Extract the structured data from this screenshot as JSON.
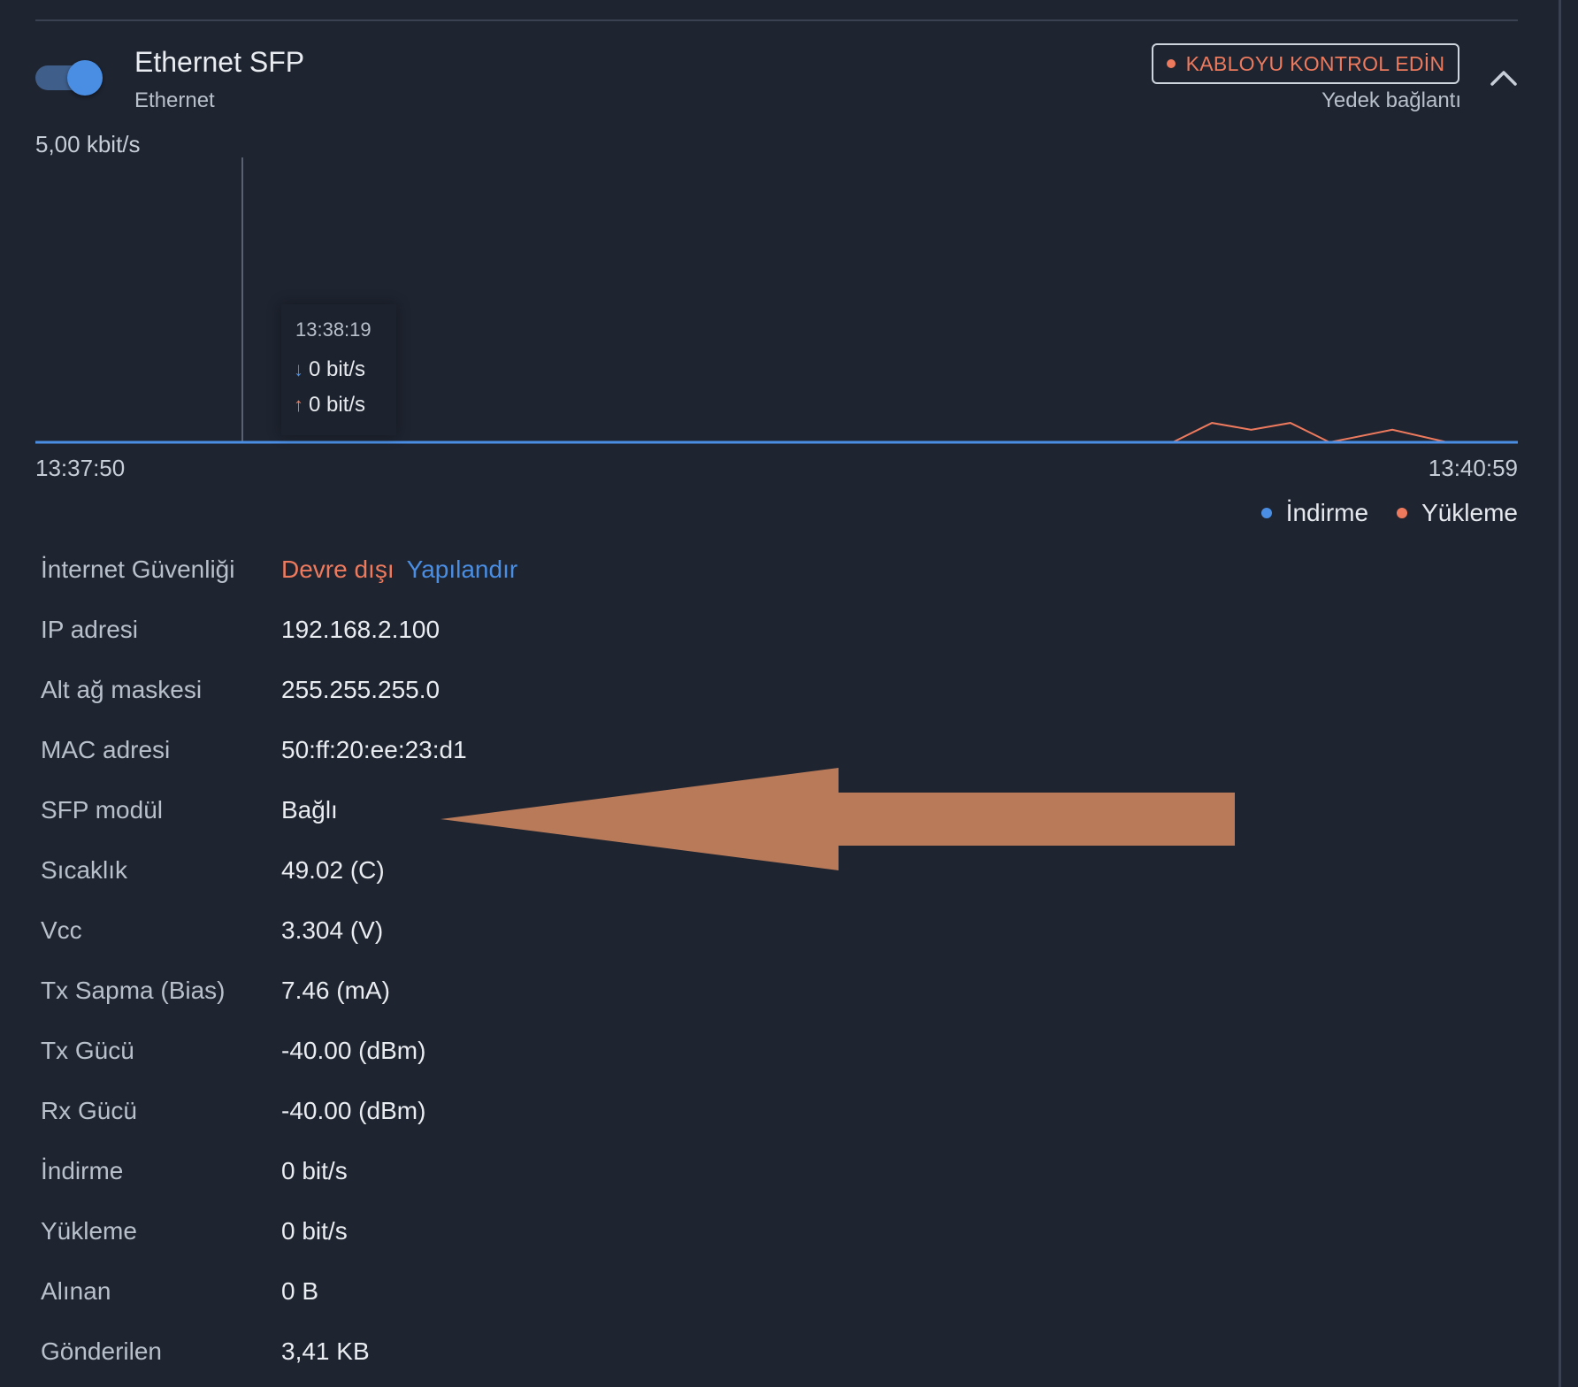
{
  "header": {
    "title": "Ethernet SFP",
    "subtitle": "Ethernet",
    "badge": "KABLOYU KONTROL EDİN",
    "backup": "Yedek bağlantı",
    "toggle_on": true
  },
  "colors": {
    "download": "#4a8ee4",
    "upload": "#ee7a5e",
    "background": "#1e2430",
    "annotation_arrow": "#b97a59"
  },
  "chart_data": {
    "type": "line",
    "ylabel": "",
    "y_max_label": "5,00 kbit/s",
    "ylim": [
      0,
      5000
    ],
    "x_start": "13:37:50",
    "x_end": "13:40:59",
    "legend_position": "bottom-right",
    "series": [
      {
        "name": "İndirme",
        "x": [
          "13:37:50",
          "13:40:59"
        ],
        "values": [
          0,
          0
        ]
      },
      {
        "name": "Yükleme",
        "x": [
          "13:37:50",
          "13:40:15",
          "13:40:20",
          "13:40:25",
          "13:40:30",
          "13:40:35",
          "13:40:43",
          "13:40:50",
          "13:40:59"
        ],
        "values": [
          0,
          0,
          340,
          220,
          340,
          0,
          220,
          0,
          0
        ]
      }
    ],
    "tooltip": {
      "time": "13:38:19",
      "download": "0 bit/s",
      "upload": "0 bit/s"
    }
  },
  "details": [
    {
      "label": "İnternet Güvenliği",
      "value": "Devre dışı",
      "action": "Yapılandır"
    },
    {
      "label": "IP adresi",
      "value": "192.168.2.100"
    },
    {
      "label": "Alt ağ maskesi",
      "value": "255.255.255.0"
    },
    {
      "label": "MAC adresi",
      "value": "50:ff:20:ee:23:d1"
    },
    {
      "label": "SFP modül",
      "value": "Bağlı"
    },
    {
      "label": "Sıcaklık",
      "value": "49.02 (C)"
    },
    {
      "label": "Vcc",
      "value": "3.304 (V)"
    },
    {
      "label": "Tx Sapma (Bias)",
      "value": "7.46 (mA)"
    },
    {
      "label": "Tx Gücü",
      "value": "-40.00 (dBm)"
    },
    {
      "label": "Rx Gücü",
      "value": "-40.00 (dBm)"
    },
    {
      "label": "İndirme",
      "value": "0 bit/s"
    },
    {
      "label": "Yükleme",
      "value": "0 bit/s"
    },
    {
      "label": "Alınan",
      "value": "0 B"
    },
    {
      "label": "Gönderilen",
      "value": "3,41 KB"
    }
  ]
}
